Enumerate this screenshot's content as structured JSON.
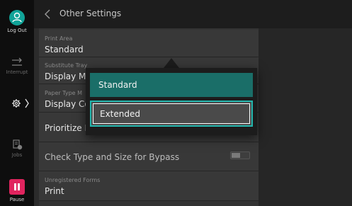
{
  "header": {
    "title": "Other Settings"
  },
  "rail": {
    "logout_label": "Log Out",
    "interrupt_label": "Interrupt",
    "jobs_label": "Jobs",
    "pause_label": "Pause"
  },
  "rows": [
    {
      "label": "Print Area",
      "value": "Standard"
    },
    {
      "label": "Substitute Tray",
      "value": "Display Me"
    },
    {
      "label": "Paper Type M",
      "value": "Display Con"
    },
    {
      "label": "",
      "value": "Prioritize B"
    },
    {
      "label": "",
      "value": "Check Type and Size for Bypass",
      "toggle_on": false
    },
    {
      "label": "Unregistered Forms",
      "value": "Print"
    }
  ],
  "popup": {
    "options": [
      "Standard",
      "Extended"
    ],
    "selected": "Extended"
  },
  "colors": {
    "accent": "#11a398",
    "pause": "#e0245e",
    "option_highlight": "#1a6e68"
  }
}
